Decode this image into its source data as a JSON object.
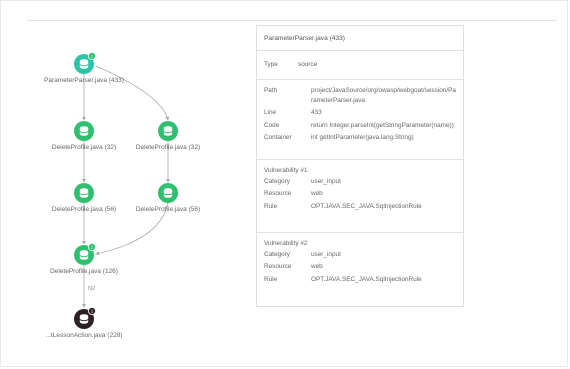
{
  "graph": {
    "nodes": [
      {
        "id": "n1",
        "label": "ParameterParser.java (433)",
        "badge": "1",
        "color": "teal"
      },
      {
        "id": "n2",
        "label": "DeleteProfile.java (32)",
        "badge": "",
        "color": "green"
      },
      {
        "id": "n3",
        "label": "DeleteProfile.java (32)",
        "badge": "",
        "color": "green"
      },
      {
        "id": "n4",
        "label": "DeleteProfile.java (56)",
        "badge": "",
        "color": "green"
      },
      {
        "id": "n5",
        "label": "DeleteProfile.java (56)",
        "badge": "",
        "color": "green"
      },
      {
        "id": "n6",
        "label": "DeleteProfile.java (126)",
        "badge": "1",
        "color": "green"
      },
      {
        "id": "n7",
        "label": "...tLessonAction.java (228)",
        "badge": "1",
        "color": "dark"
      }
    ],
    "edge_label": "N2"
  },
  "details": {
    "title": "ParameterParser.java (433)",
    "type_key": "Type",
    "type_value": "source",
    "path_key": "Path",
    "path_value": "project/JavaSource/org/owasp/webgoat/session/ParameterParser.java",
    "line_key": "Line",
    "line_value": "433",
    "code_key": "Code",
    "code_value": "return Integer.parseInt(getStringParameter(name));",
    "container_key": "Container",
    "container_value": "int getIntParameter(java.lang.String)"
  },
  "vulnerabilities": [
    {
      "heading": "Vulnerability #1",
      "category_key": "Category",
      "category": "user_input",
      "resource_key": "Resource",
      "resource": "web",
      "rule_key": "Rule",
      "rule": "OPT.JAVA.SEC_JAVA.SqlInjectionRule"
    },
    {
      "heading": "Vulnerability #2",
      "category_key": "Category",
      "category": "user_input",
      "resource_key": "Resource",
      "resource": "web",
      "rule_key": "Rule",
      "rule": "OPT.JAVA.SEC_JAVA.SqlInjectionRule"
    }
  ],
  "colors": {
    "teal": "#2bc4a6",
    "green": "#2fbf6f",
    "dark": "#2b2026",
    "badge": "#2fbf6f",
    "badge_dark": "#2b2026",
    "edge": "#a8a8a8"
  }
}
